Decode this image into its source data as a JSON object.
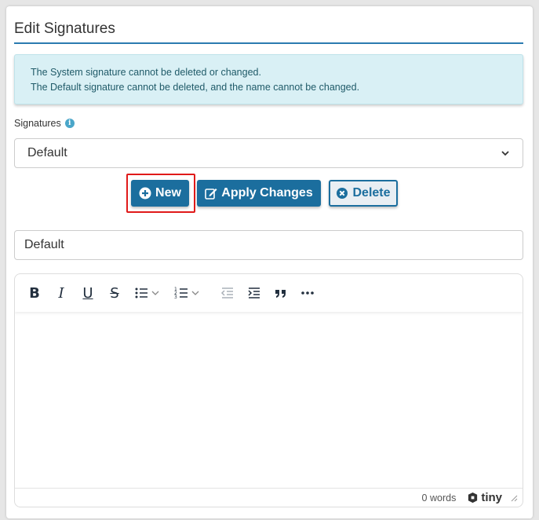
{
  "page": {
    "title": "Edit Signatures"
  },
  "info": {
    "line1": "The System signature cannot be deleted or changed.",
    "line2": "The Default signature cannot be deleted, and the name cannot be changed."
  },
  "signatures": {
    "label": "Signatures",
    "selected": "Default"
  },
  "buttons": {
    "new": "New",
    "apply": "Apply Changes",
    "delete": "Delete"
  },
  "name_field": {
    "value": "Default"
  },
  "editor": {
    "toolbar": [
      "bold-icon",
      "italic-icon",
      "underline-icon",
      "strikethrough-icon",
      "bullet-list-icon",
      "numbered-list-icon",
      "outdent-icon",
      "indent-icon",
      "blockquote-icon",
      "more-icon"
    ],
    "word_count": "0 words",
    "brand": "tiny"
  },
  "colors": {
    "accent": "#1b6e9e",
    "info_bg": "#d9f0f5",
    "focus": "#e01a1a"
  }
}
